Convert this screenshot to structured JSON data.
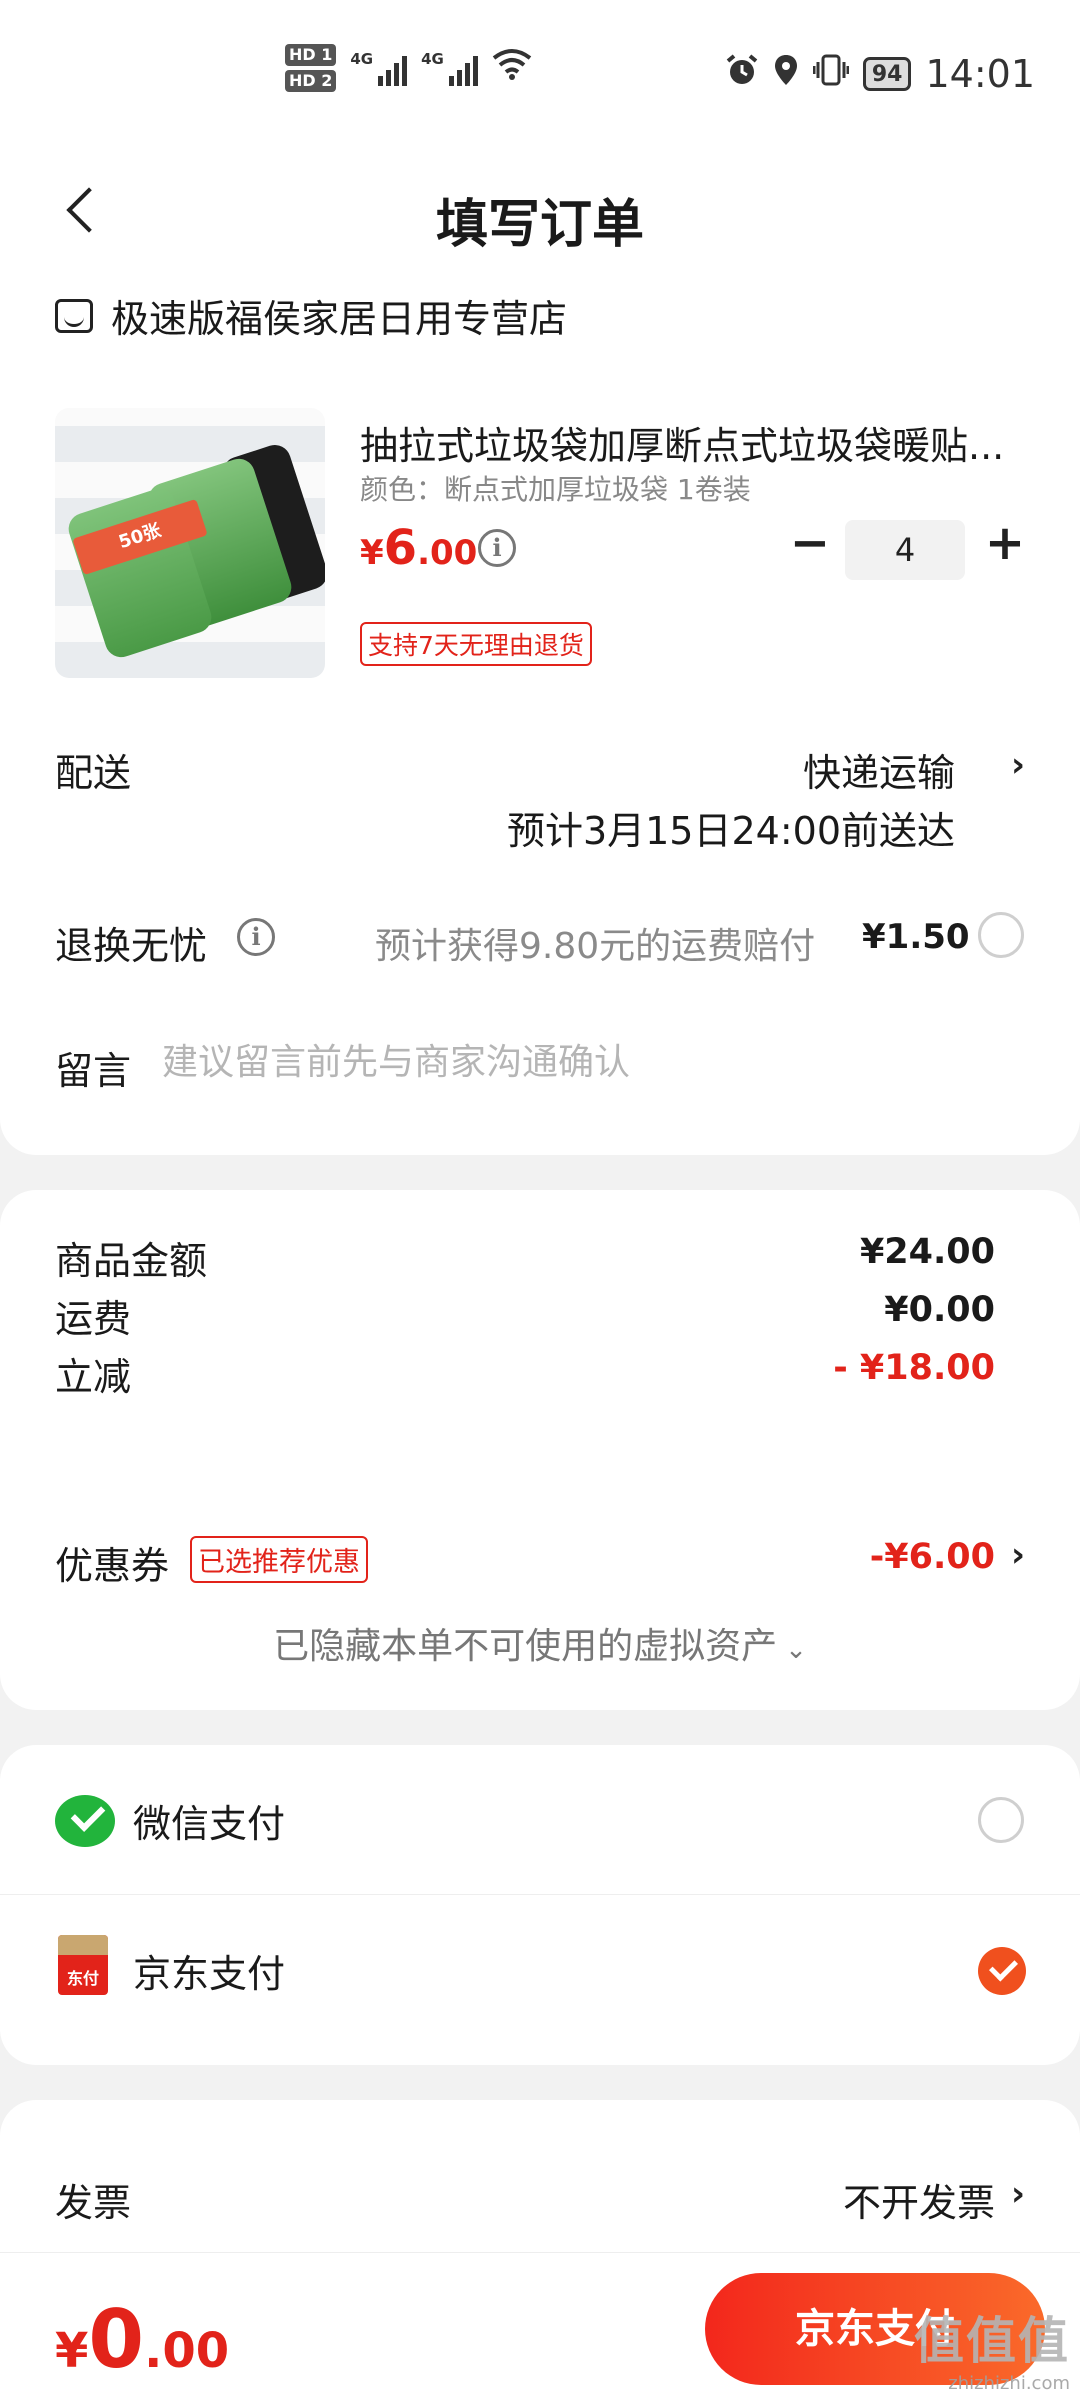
{
  "status_bar": {
    "hd1": "HD 1",
    "hd2": "HD 2",
    "net1": "4G",
    "net2": "4G",
    "battery": "94",
    "time": "14:01"
  },
  "header": {
    "title": "填写订单"
  },
  "store": {
    "name": "极速版福侯家居日用专营店"
  },
  "product": {
    "title": "抽拉式垃圾袋加厚断点式垃圾袋暖贴...",
    "spec": "颜色：断点式加厚垃圾袋 1卷装",
    "price_currency": "¥",
    "price_int": "6",
    "price_dec": ".00",
    "quantity": "4",
    "minus": "−",
    "plus": "+",
    "return_badge": "支持7天无理由退货",
    "image_label": "50张"
  },
  "delivery": {
    "label": "配送",
    "method": "快递运输",
    "eta": "预计3月15日24:00前送达"
  },
  "return_worry": {
    "label": "退换无忧",
    "desc": "预计获得9.80元的运费赔付",
    "price": "¥1.50"
  },
  "message": {
    "label": "留言",
    "placeholder": "建议留言前先与商家沟通确认"
  },
  "summary": {
    "goods_label": "商品金额",
    "goods_value": "¥24.00",
    "shipping_label": "运费",
    "shipping_value": "¥0.00",
    "discount_label": "立减",
    "discount_value": "- ¥18.00",
    "coupon_label": "优惠券",
    "coupon_badge": "已选推荐优惠",
    "coupon_value": "-¥6.00",
    "hidden_assets": "已隐藏本单不可使用的虚拟资产"
  },
  "payment": {
    "wechat": "微信支付",
    "jd": "京东支付",
    "jd_icon_text": "东付",
    "selected": "jd"
  },
  "invoice": {
    "label": "发票",
    "value": "不开发票"
  },
  "bottom": {
    "total_currency": "¥",
    "total_int": "0",
    "total_dec": ".00",
    "pay_button": "京东支付"
  },
  "watermark": {
    "main": "值值值",
    "sub": "zhizhizhi.com"
  },
  "colors": {
    "accent_red": "#e2231a",
    "pay_button_start": "#f3271c",
    "pay_button_end": "#fa6a2a",
    "wechat_green": "#22b43c",
    "check_orange": "#f0501e"
  }
}
